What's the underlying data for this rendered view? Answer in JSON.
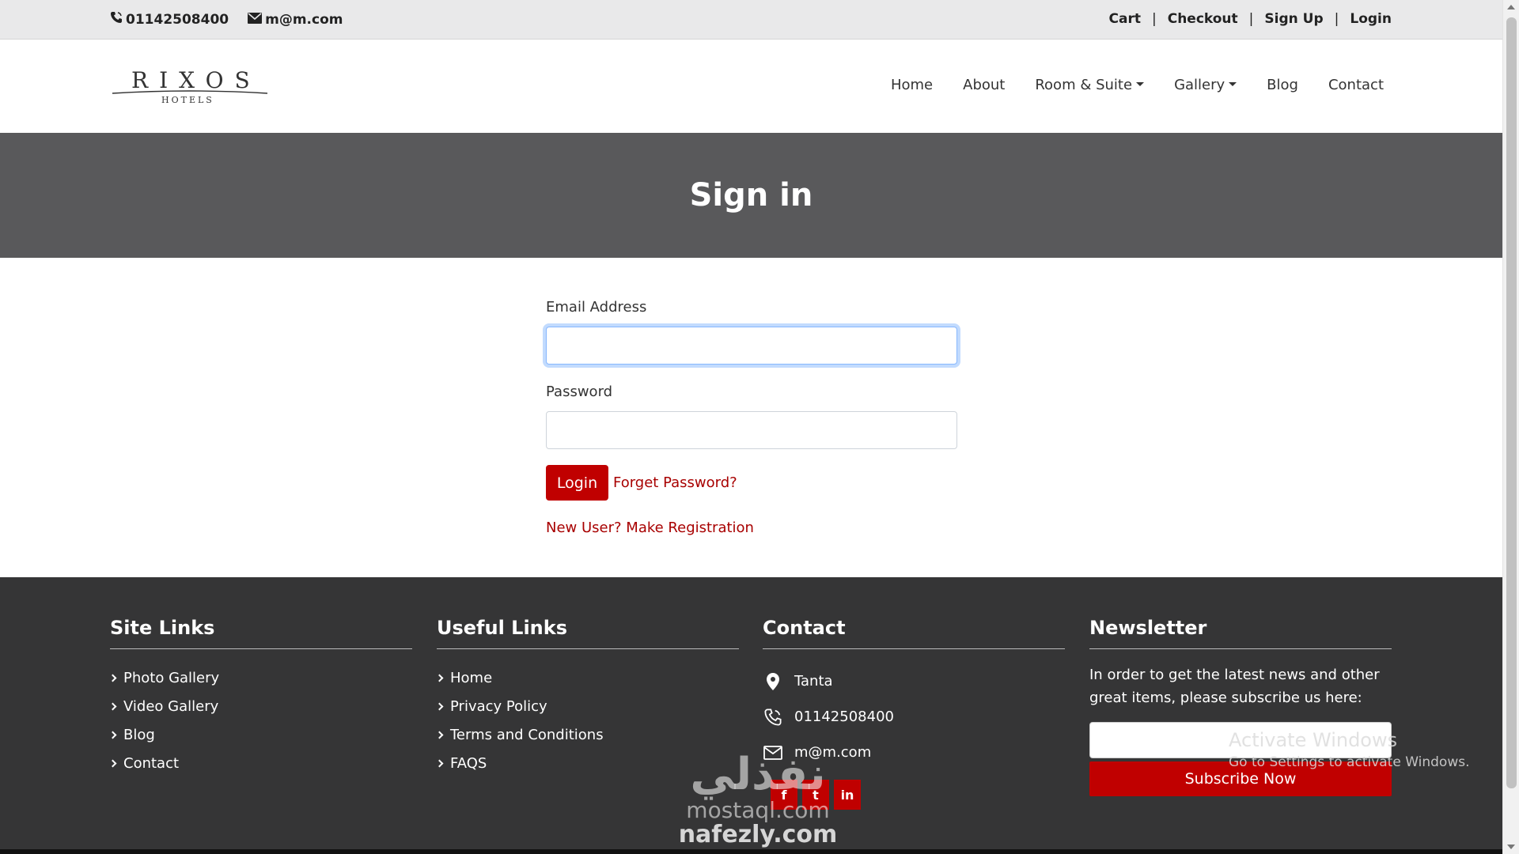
{
  "topbar": {
    "phone": "01142508400",
    "email": "m@m.com",
    "links": [
      "Cart",
      "Checkout",
      "Sign Up",
      "Login"
    ],
    "separator": "|"
  },
  "logo": {
    "name": "RIXOS",
    "sub": "HOTELS"
  },
  "nav": {
    "items": [
      {
        "label": "Home",
        "dropdown": false
      },
      {
        "label": "About",
        "dropdown": false
      },
      {
        "label": "Room & Suite",
        "dropdown": true
      },
      {
        "label": "Gallery",
        "dropdown": true
      },
      {
        "label": "Blog",
        "dropdown": false
      },
      {
        "label": "Contact",
        "dropdown": false
      }
    ]
  },
  "banner": {
    "title": "Sign in"
  },
  "form": {
    "email_label": "Email Address",
    "email_value": "",
    "password_label": "Password",
    "password_value": "",
    "login_button": "Login",
    "forgot_link": "Forget Password?",
    "register_link": "New User? Make Registration"
  },
  "footer": {
    "site_links": {
      "title": "Site Links",
      "items": [
        "Photo Gallery",
        "Video Gallery",
        "Blog",
        "Contact"
      ]
    },
    "useful_links": {
      "title": "Useful Links",
      "items": [
        "Home",
        "Privacy Policy",
        "Terms and Conditions",
        "FAQS"
      ]
    },
    "contact": {
      "title": "Contact",
      "location": "Tanta",
      "phone": "01142508400",
      "email": "m@m.com",
      "socials": [
        "f",
        "t",
        "in"
      ]
    },
    "newsletter": {
      "title": "Newsletter",
      "text": "In order to get the latest news and other great items, please subscribe us here:",
      "input_value": "",
      "button": "Subscribe Now"
    }
  },
  "overlay": {
    "activate_title": "Activate Windows",
    "activate_sub": "Go to Settings to activate Windows.",
    "watermark_arabic": "نفذلي",
    "watermark_mostaql": "mostaql.com",
    "watermark_nafezly": "nafezly.com"
  },
  "colors": {
    "accent": "#c00000",
    "banner": "#59595b",
    "footer": "#353536",
    "topbar": "#e9e9ea"
  }
}
